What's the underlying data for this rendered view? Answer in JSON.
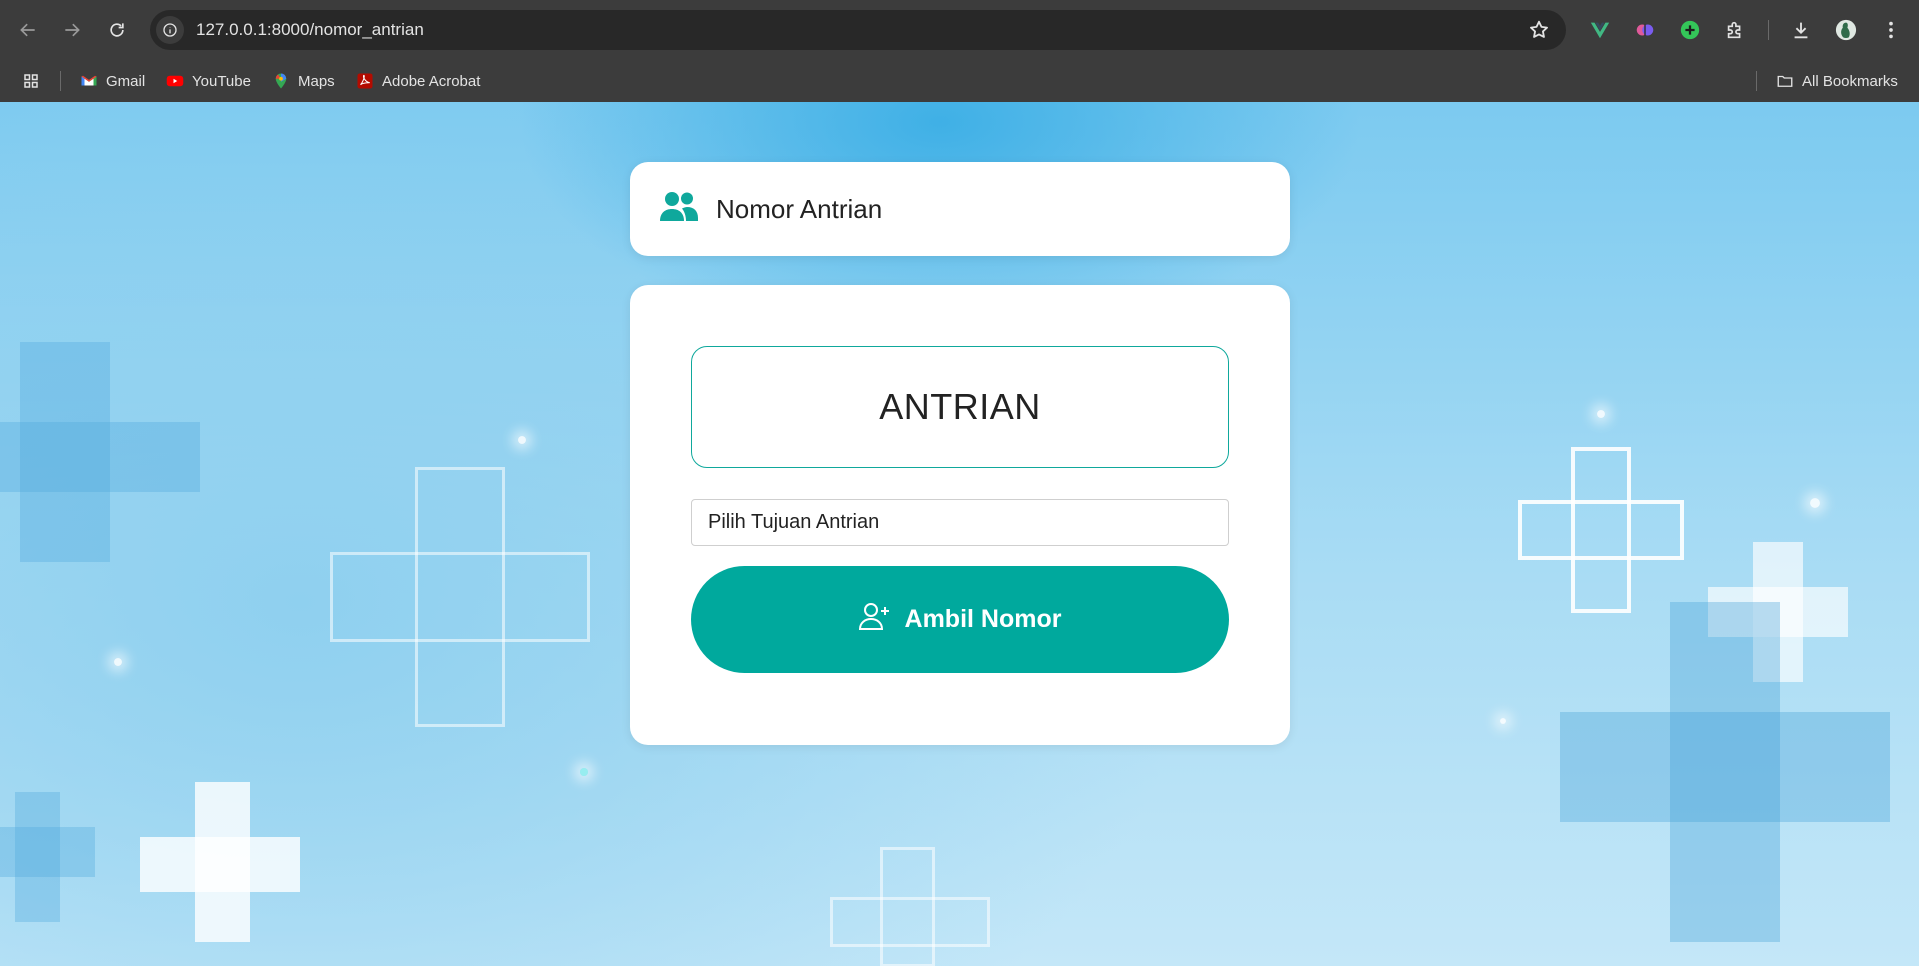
{
  "browser": {
    "url": "127.0.0.1:8000/nomor_antrian",
    "bookmarks": [
      {
        "label": "Gmail",
        "icon": "gmail-icon"
      },
      {
        "label": "YouTube",
        "icon": "youtube-icon"
      },
      {
        "label": "Maps",
        "icon": "maps-icon"
      },
      {
        "label": "Adobe Acrobat",
        "icon": "acrobat-icon"
      }
    ],
    "all_bookmarks_label": "All Bookmarks"
  },
  "header": {
    "title": "Nomor Antrian",
    "icon": "users-icon"
  },
  "queue": {
    "display_text": "ANTRIAN",
    "select_value": "Pilih Tujuan Antrian",
    "button_label": "Ambil Nomor",
    "button_icon": "user-plus-icon"
  },
  "colors": {
    "accent": "#00a99d",
    "header_icon": "#0fa89c"
  }
}
